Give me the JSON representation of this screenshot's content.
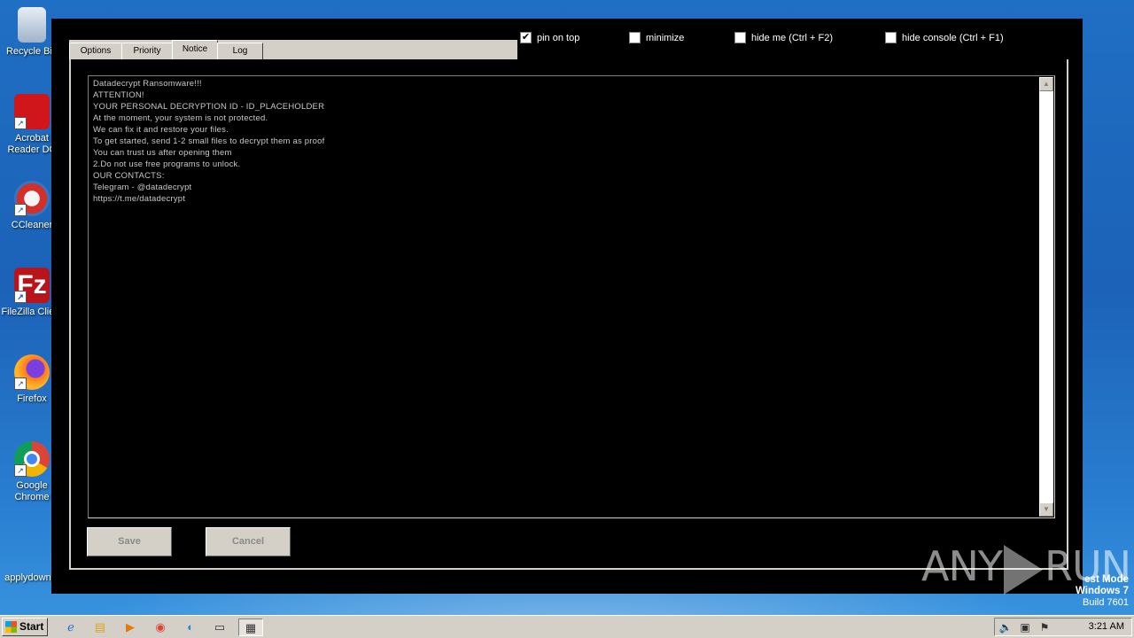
{
  "desktop": {
    "icons": [
      {
        "label": "Recycle Bin"
      },
      {
        "label": "Acrobat Reader DC"
      },
      {
        "label": "CCleaner"
      },
      {
        "label": "FileZilla Client"
      },
      {
        "label": "Firefox"
      },
      {
        "label": "Google Chrome"
      },
      {
        "label": "applydown..."
      }
    ]
  },
  "app": {
    "tabs": [
      {
        "label": "Options"
      },
      {
        "label": "Priority"
      },
      {
        "label": "Notice"
      },
      {
        "label": "Log"
      }
    ],
    "active_tab": "Notice",
    "checkboxes": [
      {
        "label": "pin on top",
        "checked": true
      },
      {
        "label": "minimize",
        "checked": false
      },
      {
        "label": "hide me (Ctrl + F2)",
        "checked": false
      },
      {
        "label": "hide console (Ctrl + F1)",
        "checked": false
      }
    ],
    "notice_lines": [
      "Datadecrypt Ransomware!!!",
      "ATTENTION!",
      "YOUR PERSONAL DECRYPTION ID - ID_PLACEHOLDER",
      "At the moment, your system is not protected.",
      "We can fix it and restore your files.",
      "To get started, send 1-2 small files to decrypt them as proof",
      "You can trust us after opening them",
      "2.Do not use free programs to unlock.",
      "OUR CONTACTS:",
      "Telegram - @datadecrypt",
      "https://t.me/datadecrypt"
    ],
    "save_label": "Save",
    "cancel_label": "Cancel"
  },
  "watermark": {
    "left": "ANY",
    "right": "RUN"
  },
  "os_info": {
    "line1": "est Mode",
    "line2": "Windows 7",
    "line3": "Build 7601"
  },
  "taskbar": {
    "start_label": "Start",
    "clock": "3:21 AM"
  }
}
